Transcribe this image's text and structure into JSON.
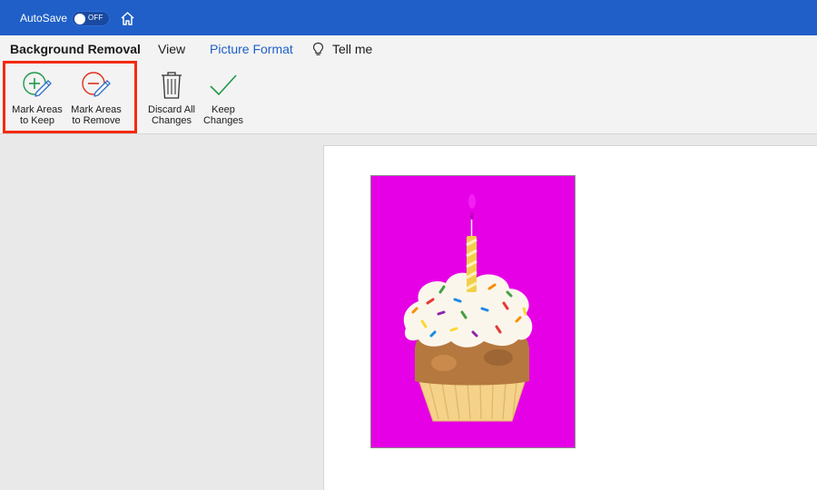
{
  "titlebar": {
    "autosave_label": "AutoSave",
    "autosave_state": "OFF",
    "home_icon": "home-icon"
  },
  "tabs": {
    "background_removal": "Background Removal",
    "view": "View",
    "picture_format": "Picture Format",
    "tell_me": "Tell me"
  },
  "ribbon": {
    "mark_keep": {
      "line1": "Mark Areas",
      "line2": "to Keep",
      "icon": "pencil-plus-icon"
    },
    "mark_remove": {
      "line1": "Mark Areas",
      "line2": "to Remove",
      "icon": "pencil-minus-icon"
    },
    "discard": {
      "line1": "Discard All",
      "line2": "Changes",
      "icon": "trash-icon"
    },
    "keep_changes": {
      "line1": "Keep",
      "line2": "Changes",
      "icon": "checkmark-icon"
    }
  },
  "colors": {
    "titlebar": "#1f5fc7",
    "highlight": "#f42a0e",
    "removal_overlay": "#e600e6",
    "keep_green": "#1f9a4a",
    "remove_red": "#e0301e"
  },
  "document": {
    "image": "cupcake-with-candle"
  }
}
